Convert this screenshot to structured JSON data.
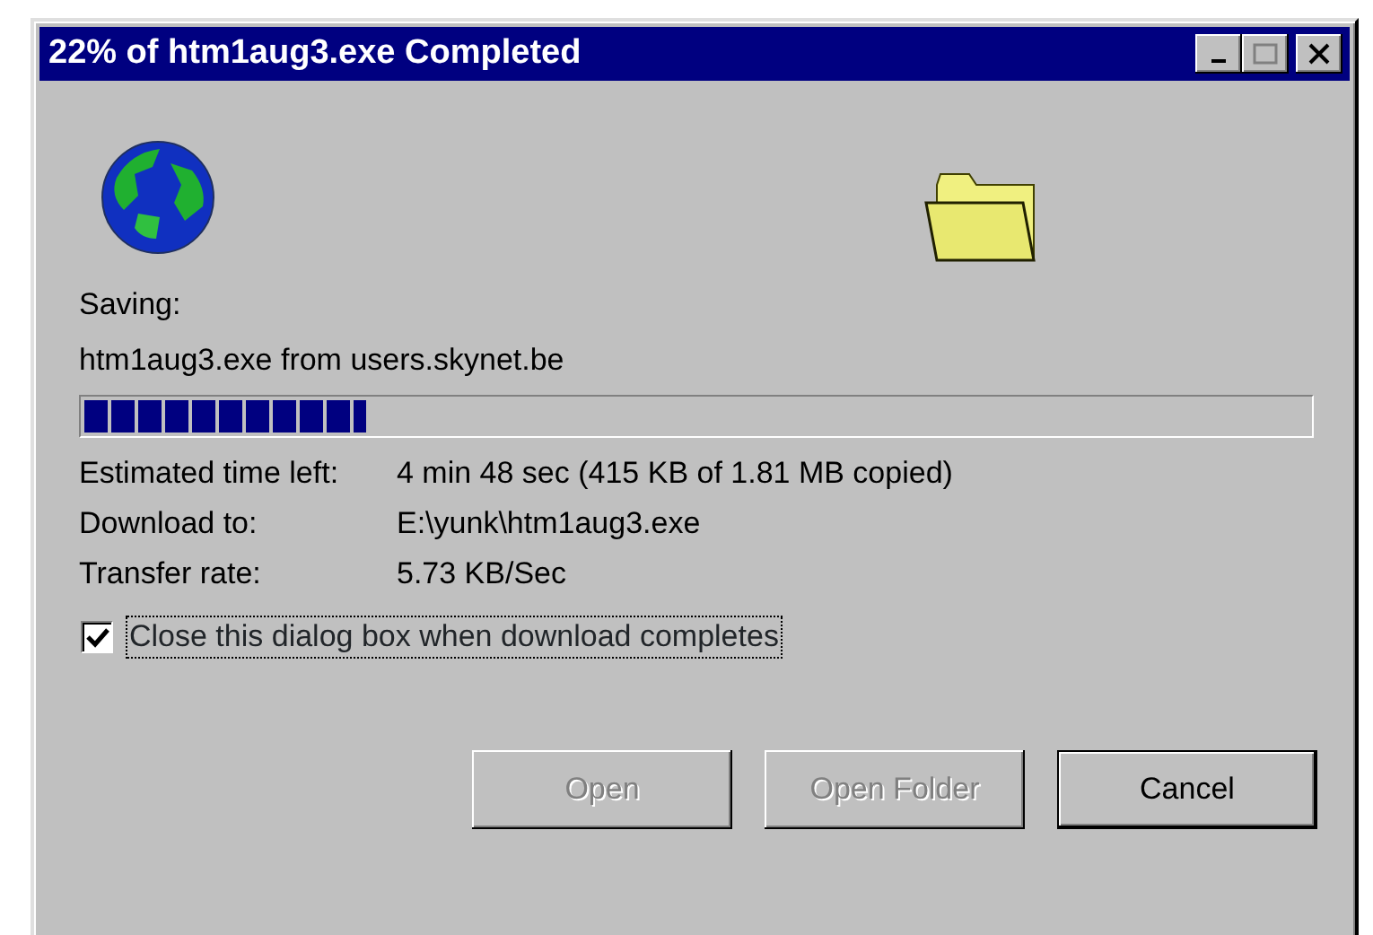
{
  "window": {
    "title": "22% of htm1aug3.exe Completed"
  },
  "saving_label": "Saving:",
  "source": "htm1aug3.exe from users.skynet.be",
  "progress": {
    "level": 0.23
  },
  "details": [
    {
      "label": "Estimated time left:",
      "value": "4 min 48 sec (415 KB of 1.81 MB copied)"
    },
    {
      "label": "Download to:",
      "value": "E:\\yunk\\htm1aug3.exe"
    },
    {
      "label": "Transfer rate:",
      "value": "5.73 KB/Sec"
    }
  ],
  "close_checkbox": {
    "label": "Close this dialog box when download completes",
    "checked": true
  },
  "buttons": [
    {
      "label": "Open",
      "disabled": true
    },
    {
      "label": "Open Folder",
      "disabled": true
    },
    {
      "label": "Cancel",
      "disabled": false
    }
  ]
}
